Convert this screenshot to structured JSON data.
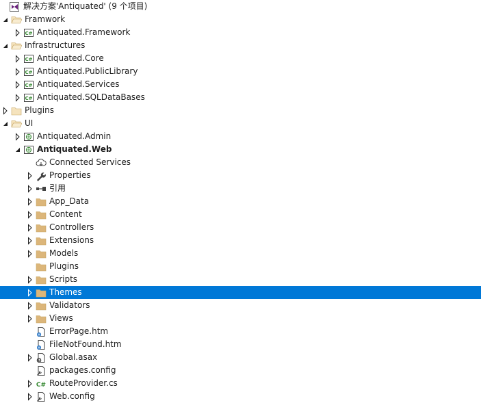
{
  "solution_explorer": {
    "colors": {
      "selected_bg": "#0078d7",
      "folder": "#dcb67a",
      "cs_green": "#388a34",
      "vs_purple": "#68217a"
    },
    "items": [
      {
        "label": "解决方案'Antiquated' (9 个项目)",
        "icon": "solution-icon",
        "level": 0,
        "expander": "none"
      },
      {
        "label": "Framwork",
        "icon": "solution-folder-open-icon",
        "level": 0,
        "expander": "expanded"
      },
      {
        "label": "Antiquated.Framework",
        "icon": "csharp-project-icon",
        "level": 1,
        "expander": "collapsed"
      },
      {
        "label": "Infrastructures",
        "icon": "solution-folder-open-icon",
        "level": 0,
        "expander": "expanded"
      },
      {
        "label": "Antiquated.Core",
        "icon": "csharp-project-icon",
        "level": 1,
        "expander": "collapsed"
      },
      {
        "label": "Antiquated.PublicLibrary",
        "icon": "csharp-project-icon",
        "level": 1,
        "expander": "collapsed"
      },
      {
        "label": "Antiquated.Services",
        "icon": "csharp-project-icon",
        "level": 1,
        "expander": "collapsed"
      },
      {
        "label": "Antiquated.SQLDataBases",
        "icon": "csharp-project-icon",
        "level": 1,
        "expander": "collapsed"
      },
      {
        "label": "Plugins",
        "icon": "solution-folder-icon",
        "level": 0,
        "expander": "collapsed"
      },
      {
        "label": "UI",
        "icon": "solution-folder-open-icon",
        "level": 0,
        "expander": "expanded"
      },
      {
        "label": "Antiquated.Admin",
        "icon": "web-project-icon",
        "level": 1,
        "expander": "collapsed"
      },
      {
        "label": "Antiquated.Web",
        "icon": "web-project-icon",
        "level": 1,
        "expander": "expanded",
        "bold": true
      },
      {
        "label": "Connected Services",
        "icon": "connected-services-icon",
        "level": 2,
        "expander": "none"
      },
      {
        "label": "Properties",
        "icon": "wrench-icon",
        "level": 2,
        "expander": "collapsed"
      },
      {
        "label": "引用",
        "icon": "references-icon",
        "level": 2,
        "expander": "collapsed"
      },
      {
        "label": "App_Data",
        "icon": "folder-icon",
        "level": 2,
        "expander": "collapsed"
      },
      {
        "label": "Content",
        "icon": "folder-icon",
        "level": 2,
        "expander": "collapsed"
      },
      {
        "label": "Controllers",
        "icon": "folder-icon",
        "level": 2,
        "expander": "collapsed"
      },
      {
        "label": "Extensions",
        "icon": "folder-icon",
        "level": 2,
        "expander": "collapsed"
      },
      {
        "label": "Models",
        "icon": "folder-icon",
        "level": 2,
        "expander": "collapsed"
      },
      {
        "label": "Plugins",
        "icon": "folder-icon",
        "level": 2,
        "expander": "none"
      },
      {
        "label": "Scripts",
        "icon": "folder-icon",
        "level": 2,
        "expander": "collapsed"
      },
      {
        "label": "Themes",
        "icon": "folder-icon",
        "level": 2,
        "expander": "collapsed",
        "selected": true
      },
      {
        "label": "Validators",
        "icon": "folder-icon",
        "level": 2,
        "expander": "collapsed"
      },
      {
        "label": "Views",
        "icon": "folder-icon",
        "level": 2,
        "expander": "collapsed"
      },
      {
        "label": "ErrorPage.htm",
        "icon": "html-file-icon",
        "level": 2,
        "expander": "none"
      },
      {
        "label": "FileNotFound.htm",
        "icon": "html-file-icon",
        "level": 2,
        "expander": "none"
      },
      {
        "label": "Global.asax",
        "icon": "asax-file-icon",
        "level": 2,
        "expander": "collapsed"
      },
      {
        "label": "packages.config",
        "icon": "config-file-icon",
        "level": 2,
        "expander": "none"
      },
      {
        "label": "RouteProvider.cs",
        "icon": "csharp-file-icon",
        "level": 2,
        "expander": "collapsed"
      },
      {
        "label": "Web.config",
        "icon": "config-file-icon",
        "level": 2,
        "expander": "collapsed"
      }
    ]
  }
}
